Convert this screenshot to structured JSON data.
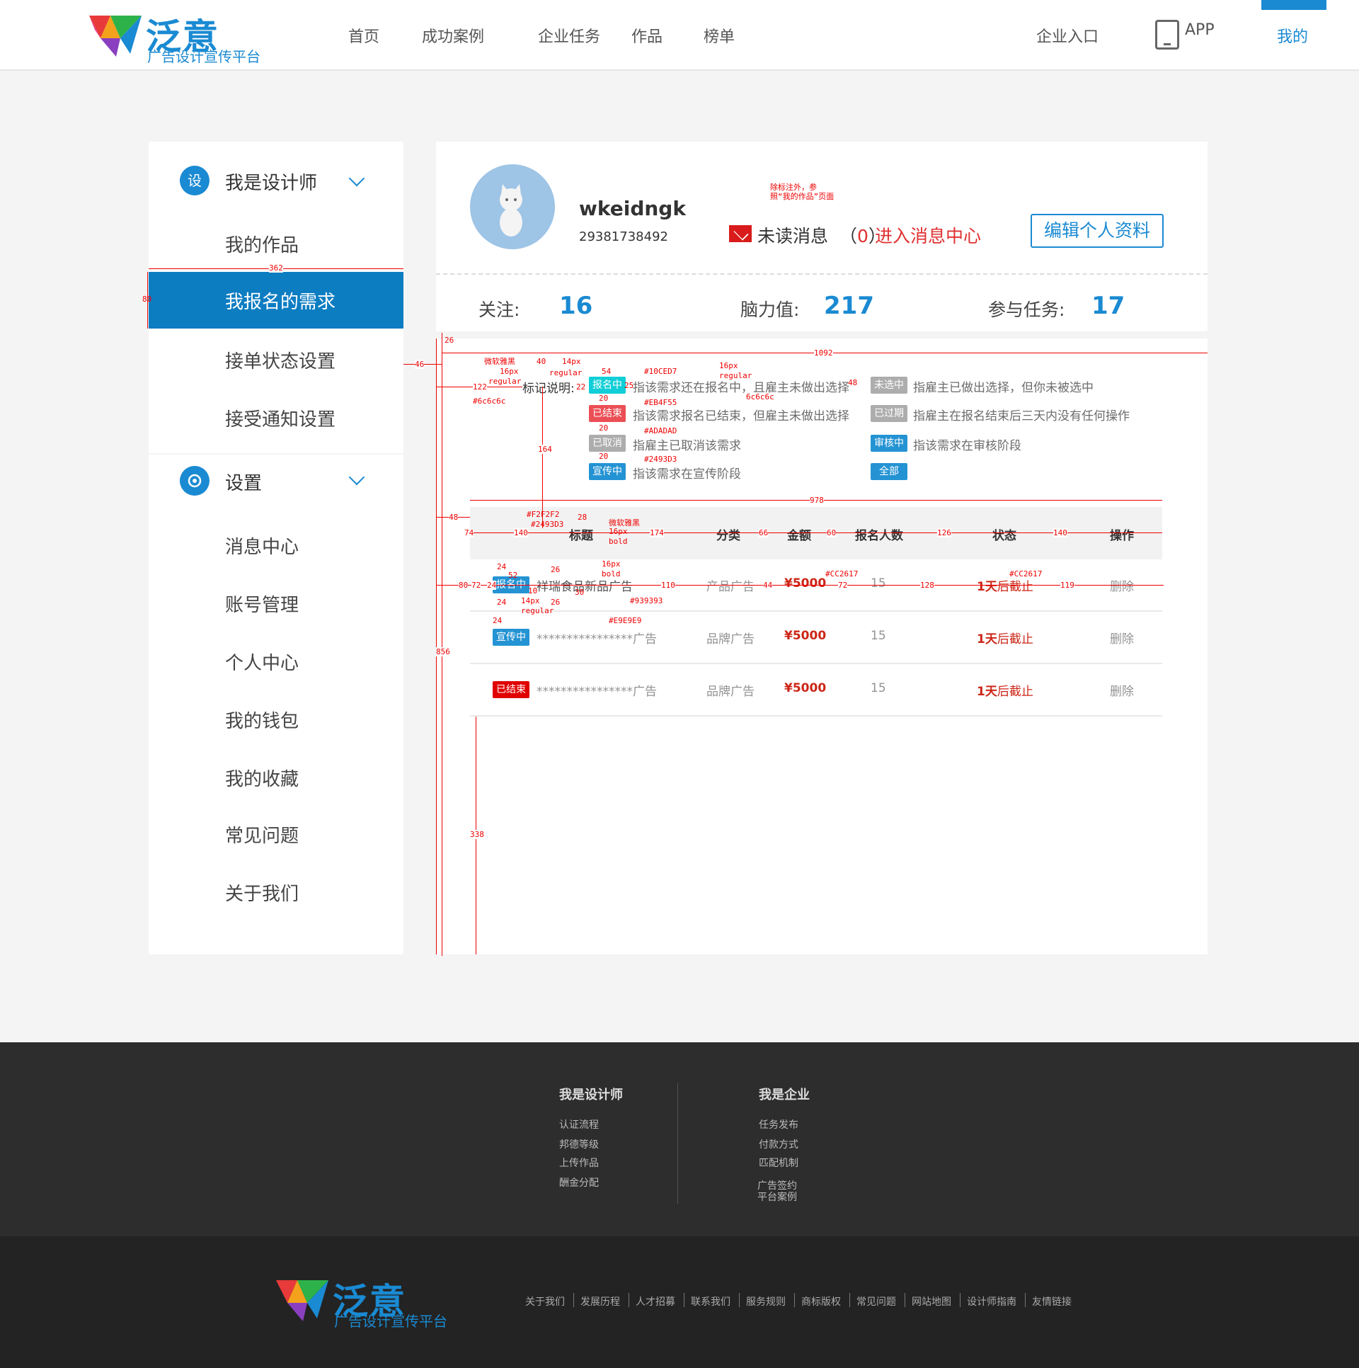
{
  "header": {
    "brand": "泛意",
    "slogan": "广告设计宣传平台",
    "nav": [
      "首页",
      "成功案例",
      "企业任务",
      "作品",
      "榜单"
    ],
    "enterprise": "企业入口",
    "app": "APP",
    "my": "我的"
  },
  "sidebar": {
    "group1": {
      "icon_text": "设",
      "title": "我是设计师"
    },
    "group1_items": [
      "我的作品",
      "我报名的需求",
      "接单状态设置",
      "接受通知设置"
    ],
    "active_item": "我报名的需求",
    "group2": {
      "title": "设置"
    },
    "group2_items": [
      "消息中心",
      "账号管理",
      "个人中心",
      "我的钱包",
      "我的收藏",
      "常见问题",
      "关于我们"
    ]
  },
  "profile": {
    "username": "wkeidngk",
    "user_id": "29381738492",
    "unread_label": "未读消息",
    "unread_open": "（",
    "unread_count": "0",
    "unread_close": "）",
    "message_center_link": "进入消息中心",
    "edit_button": "编辑个人资料",
    "stats": {
      "follow_label": "关注:",
      "follow_value": "16",
      "brain_label": "脑力值:",
      "brain_value": "217",
      "tasks_label": "参与任务:",
      "tasks_value": "17"
    }
  },
  "legend": {
    "title": "标记说明:",
    "items": [
      {
        "badge": "报名中",
        "color": "#10CED7",
        "text": "指该需求还在报名中，且雇主未做出选择"
      },
      {
        "badge": "已结束",
        "color": "#EB4F55",
        "text": "指该需求报名已结束，但雇主未做出选择"
      },
      {
        "badge": "已取消",
        "color": "#ADADAD",
        "text": "指雇主已取消该需求"
      },
      {
        "badge": "宣传中",
        "color": "#2493D3",
        "text": "指该需求在宣传阶段"
      },
      {
        "badge": "未选中",
        "color": "#ADADAD",
        "text": "指雇主已做出选择，但你未被选中"
      },
      {
        "badge": "已过期",
        "color": "#ADADAD",
        "text": "指雇主在报名结束后三天内没有任何操作"
      },
      {
        "badge": "审核中",
        "color": "#2493D3",
        "text": "指该需求在审核阶段"
      },
      {
        "badge": "全部",
        "color": "#2493D3",
        "text": ""
      }
    ]
  },
  "table": {
    "headers": [
      "标题",
      "分类",
      "金额",
      "报名人数",
      "状态",
      "操作"
    ],
    "rows": [
      {
        "badge": "报名中",
        "badge_color": "#2493D3",
        "title": "祥瑞食品新品广告",
        "category": "产品广告",
        "amount": "¥5000",
        "count": "15",
        "status_num": "1天",
        "status_rest": "后截止",
        "action": "删除"
      },
      {
        "badge": "宣传中",
        "badge_color": "#2493D3",
        "title": "****************广告",
        "category": "品牌广告",
        "amount": "¥5000",
        "count": "15",
        "status_num": "1天",
        "status_rest": "后截止",
        "action": "删除"
      },
      {
        "badge": "已结束",
        "badge_color": "#E00000",
        "title": "****************广告",
        "category": "品牌广告",
        "amount": "¥5000",
        "count": "15",
        "status_num": "1天",
        "status_rest": "后截止",
        "action": "删除"
      }
    ]
  },
  "annotations": {
    "note": "除标注外，参照“我的作品”页面",
    "w362": "362",
    "h80": "80",
    "w26": "26",
    "w1092": "1092",
    "w46": "46",
    "w122": "122",
    "font1": "微软雅黑",
    "font1_size": "16px",
    "font1_weight": "regular",
    "font1_color": "#6c6c6c",
    "w40": "40",
    "w14px": "14px",
    "w14reg": "regular",
    "w54": "54",
    "c10": "#10CED7",
    "w16px": "16px",
    "w16reg": "regular",
    "c6c": "6c6c6c",
    "w22": "22",
    "w25": "25",
    "w48": "48",
    "w20a": "20",
    "cEB": "#EB4F55",
    "w20b": "20",
    "cAD": "#ADADAD",
    "w20c": "20",
    "c24": "#2493D3",
    "w164": "164",
    "w978": "978",
    "cF2": "#F2F2F2",
    "c24b": "#2493D3",
    "w28": "28",
    "font2": "微软雅黑",
    "font2_size": "16px",
    "font2_weight": "bold",
    "w48b": "48",
    "w74": "74",
    "w140": "140",
    "w174": "174",
    "w66": "66",
    "w60": "60",
    "w126": "126",
    "w140b": "140",
    "w24": "24",
    "w52": "52",
    "w26b": "26",
    "w16pxb": "16px",
    "w16bold": "bold",
    "cCC": "#CC2617",
    "cCCb": "#CC2617",
    "w80": "80",
    "w72": "72",
    "w24b": "24",
    "w10": "10",
    "w30": "30",
    "w110": "110",
    "w44": "44",
    "w72b": "72",
    "w128": "128",
    "w119": "119",
    "w24c": "24",
    "w14pxb": "14px",
    "w14regb": "regular",
    "w26c": "26",
    "c93": "#939393",
    "w24d": "24",
    "cE9": "#E9E9E9",
    "w856": "856",
    "w338": "338"
  },
  "footer": {
    "col1_title": "我是设计师",
    "col1_links": [
      "认证流程",
      "邦德等级",
      "上传作品",
      "酬金分配"
    ],
    "col2_title": "我是企业",
    "col2_links": [
      "任务发布",
      "付款方式",
      "匹配机制"
    ],
    "col2_extra": [
      "广告签约",
      "平台案例"
    ],
    "bottom_links": [
      "关于我们",
      "发展历程",
      "人才招募",
      "联系我们",
      "服务规则",
      "商标版权",
      "常见问题",
      "网站地图",
      "设计师指南",
      "友情链接"
    ]
  }
}
